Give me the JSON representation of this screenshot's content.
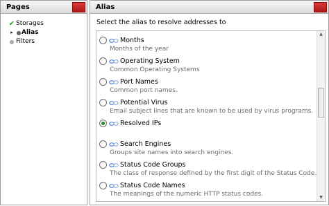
{
  "left_pane": {
    "title": "Pages",
    "items": [
      {
        "label": "Storages",
        "state": "check"
      },
      {
        "label": "Alias",
        "state": "current"
      },
      {
        "label": "Filters",
        "state": "bullet"
      }
    ]
  },
  "right_pane": {
    "title": "Alias",
    "instruction": "Select the alias to resolve addresses to",
    "aliases": [
      {
        "name": "Months",
        "description": "Months of the year",
        "selected": false
      },
      {
        "name": "Operating System",
        "description": "Common Operating Systems",
        "selected": false
      },
      {
        "name": "Port Names",
        "description": "Common port names.",
        "selected": false
      },
      {
        "name": "Potential Virus",
        "description": "Email subject lines that are known to be used by virus programs.",
        "selected": false
      },
      {
        "name": "Resolved IPs",
        "description": "",
        "selected": true
      },
      {
        "name": "Search Engines",
        "description": "Groups site names into search engines.",
        "selected": false
      },
      {
        "name": "Status Code Groups",
        "description": "The class of response defined by the first digit of the Status Code.",
        "selected": false
      },
      {
        "name": "Status Code Names",
        "description": "The meanings of the numeric HTTP status codes.",
        "selected": false
      }
    ]
  },
  "icons": {
    "alias_icon": "link-chain-icon",
    "check_icon": "green-check-icon",
    "bullet_icon": "bullet-icon"
  },
  "colors": {
    "header_close_red": "#c42020",
    "check_green": "#2a9a2a",
    "link_icon_blue": "#4a7fd0",
    "description_gray": "#6a6a6a"
  }
}
